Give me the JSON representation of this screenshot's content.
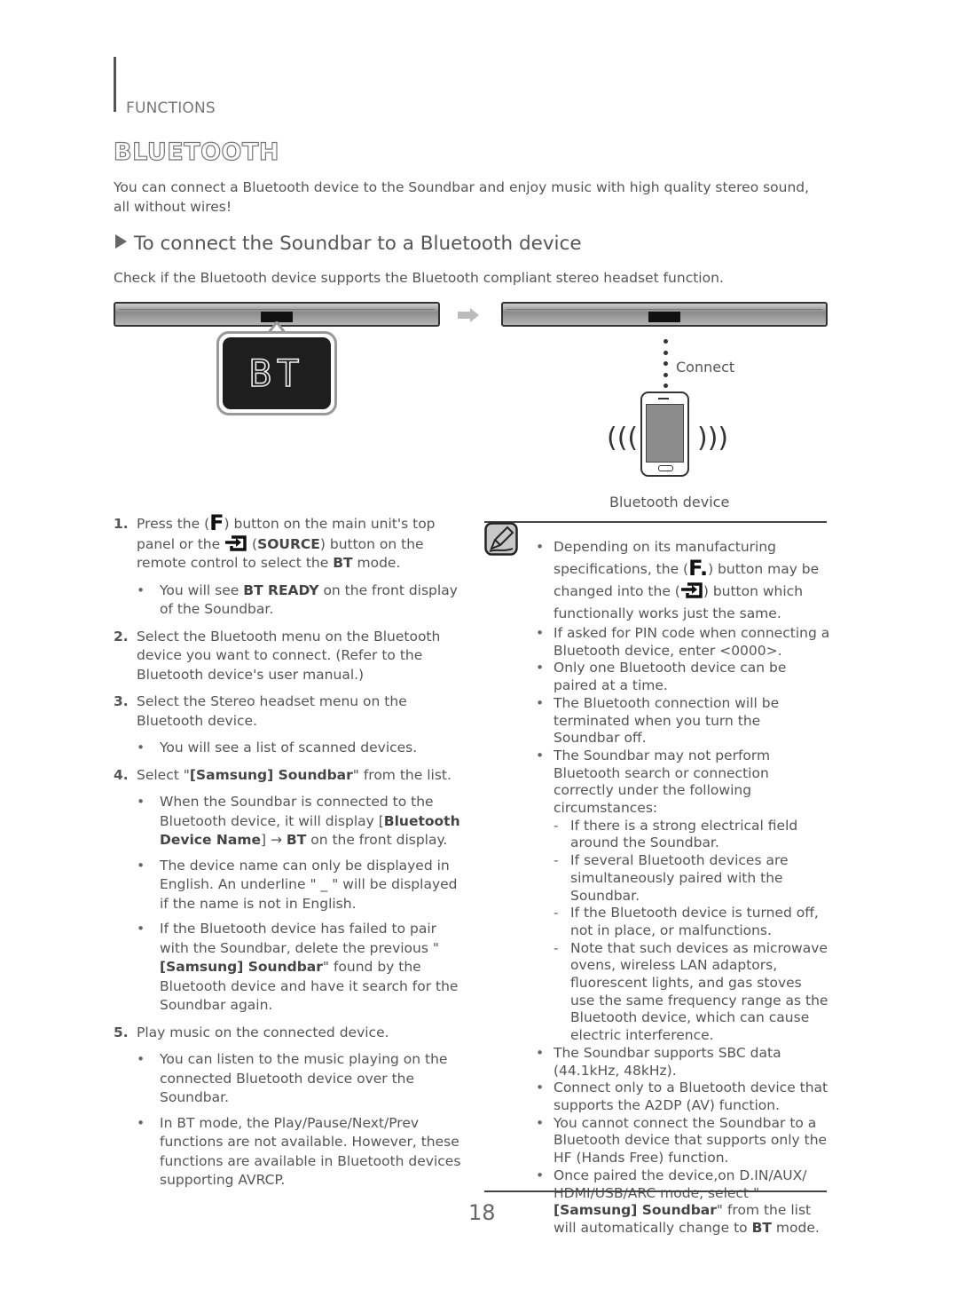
{
  "header": {
    "section": "FUNCTIONS",
    "title": "BLUETOOTH"
  },
  "intro": "You can connect a Bluetooth device to the Soundbar and enjoy music with high quality stereo sound, all without wires!",
  "subheading": "To connect the Soundbar to a Bluetooth device",
  "check_text": "Check if the Bluetooth device supports the Bluetooth compliant stereo headset function.",
  "illustration": {
    "display_text": "BT",
    "connect_label": "Connect",
    "device_label": "Bluetooth device"
  },
  "steps": {
    "s1": {
      "num": "1.",
      "a": "Press the (",
      "f_icon": "F",
      "b": ") button on the main unit's top panel or the ",
      "c": " (",
      "source": "SOURCE",
      "d": ") button on the remote control to select the ",
      "bt": "BT",
      "e": " mode.",
      "bullet1_a": "You will see ",
      "bullet1_bold": "BT READY",
      "bullet1_b": " on the front display of the Soundbar."
    },
    "s2": {
      "num": "2.",
      "text": "Select the Bluetooth menu on the Bluetooth device you want to connect. (Refer to the Bluetooth device's user manual.)"
    },
    "s3": {
      "num": "3.",
      "text": "Select the Stereo headset menu on the Bluetooth device.",
      "bullet1": "You will see a list of scanned devices."
    },
    "s4": {
      "num": "4.",
      "a": "Select \"",
      "bold": "[Samsung] Soundbar",
      "b": "\" from the list.",
      "bullet1_a": "When the Soundbar is connected to the Bluetooth device, it will display [",
      "bullet1_bold1": "Bluetooth Device Name",
      "bullet1_b": "] → ",
      "bullet1_bold2": "BT",
      "bullet1_c": " on the front display.",
      "bullet2": "The device name can only be displayed in English. An underline \" _ \" will be displayed if the name is not in English.",
      "bullet3_a": "If the Bluetooth device has failed to pair with the Soundbar, delete the previous \"",
      "bullet3_bold": "[Samsung] Soundbar",
      "bullet3_b": "\" found by the Bluetooth device and have it search for the Soundbar again."
    },
    "s5": {
      "num": "5.",
      "text": "Play music on the connected device.",
      "bullet1": "You can listen to the music playing on the connected Bluetooth device over the Soundbar.",
      "bullet2": "In BT mode, the Play/Pause/Next/Prev functions are not available. However, these functions are available in Bluetooth devices supporting AVRCP."
    }
  },
  "notes": {
    "n1_a": "Depending on its manufacturing specifications, the (",
    "n1_f": "F.",
    "n1_b": ") button may be changed into the (",
    "n1_c": ") button which functionally works just the same.",
    "n2": "If asked for PIN code when connecting a Bluetooth device, enter <0000>.",
    "n3": "Only one Bluetooth device can be paired at a time.",
    "n4": "The Bluetooth connection will be terminated when you turn the Soundbar off.",
    "n5": "The Soundbar may not perform Bluetooth search or connection correctly under the following circumstances:",
    "n5_d1": "If there is a strong electrical field around the Soundbar.",
    "n5_d2": "If several Bluetooth devices are simultaneously paired with the Soundbar.",
    "n5_d3": "If the Bluetooth device is turned off, not in place, or malfunctions.",
    "n5_d4": "Note that such devices as microwave ovens, wireless LAN adaptors, fluorescent lights, and gas stoves use the same frequency range as the Bluetooth device, which can cause electric interference.",
    "n6": "The Soundbar supports SBC data (44.1kHz, 48kHz).",
    "n7": "Connect only to a Bluetooth device that supports the A2DP (AV) function.",
    "n8": "You cannot connect the Soundbar to a Bluetooth device that supports only the HF (Hands Free) function.",
    "n9_a": "Once paired the device,on D.IN/AUX/ HDMI/USB/ARC mode, select \"",
    "n9_bold": "[Samsung] Soundbar",
    "n9_b": "\" from the list will automatically change to ",
    "n9_bt": "BT",
    "n9_c": " mode."
  },
  "page_number": "18"
}
